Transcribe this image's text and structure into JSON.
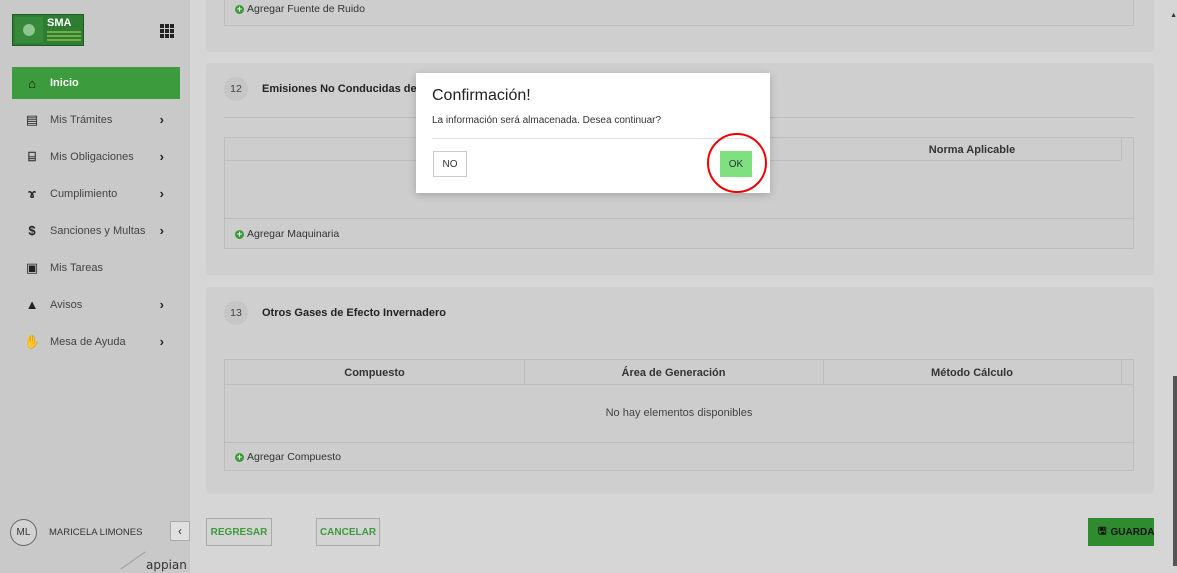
{
  "sidebar": {
    "logo": {
      "text": "SMA"
    },
    "nav": [
      {
        "label": "Inicio",
        "icon": "home-icon",
        "glyph": "⌂",
        "active": true,
        "chevron": false
      },
      {
        "label": "Mis Trámites",
        "icon": "document-icon",
        "glyph": "▤",
        "active": false,
        "chevron": true
      },
      {
        "label": "Mis Obligaciones",
        "icon": "bank-icon",
        "glyph": "⌸",
        "active": false,
        "chevron": true
      },
      {
        "label": "Cumplimiento",
        "icon": "cumplimiento-icon",
        "glyph": "ɤ",
        "active": false,
        "chevron": true
      },
      {
        "label": "Sanciones y Multas",
        "icon": "money-icon",
        "glyph": "$",
        "active": false,
        "chevron": true
      },
      {
        "label": "Mis Tareas",
        "icon": "briefcase-icon",
        "glyph": "▣",
        "active": false,
        "chevron": false
      },
      {
        "label": "Avisos",
        "icon": "warning-icon",
        "glyph": "▲",
        "active": false,
        "chevron": true
      },
      {
        "label": "Mesa de Ayuda",
        "icon": "handshake-icon",
        "glyph": "✋",
        "active": false,
        "chevron": true
      }
    ],
    "user": {
      "initials": "ML",
      "name": "MARICELA LIMONES"
    },
    "brand": "appian"
  },
  "main": {
    "top_section": {
      "add_label": "Agregar Fuente de Ruido"
    },
    "section12": {
      "number": "12",
      "title": "Emisiones No Conducidas de M",
      "header_right": "Norma Aplicable",
      "add_label": "Agregar Maquinaria"
    },
    "section13": {
      "number": "13",
      "title": "Otros Gases de Efecto Invernadero",
      "columns": [
        "Compuesto",
        "Área de Generación",
        "Método Cálculo"
      ],
      "empty_text": "No hay elementos disponibles",
      "add_label": "Agregar Compuesto"
    },
    "footer": {
      "back_label": "REGRESAR",
      "cancel_label": "CANCELAR",
      "save_label": "GUARDA"
    }
  },
  "modal": {
    "title": "Confirmación!",
    "message": "La información será almacenada. Desea continuar?",
    "no_label": "NO",
    "ok_label": "OK"
  },
  "colors": {
    "accent_green": "#3c9b3c",
    "ok_green": "#7ee07e",
    "highlight_red": "#e00000"
  }
}
